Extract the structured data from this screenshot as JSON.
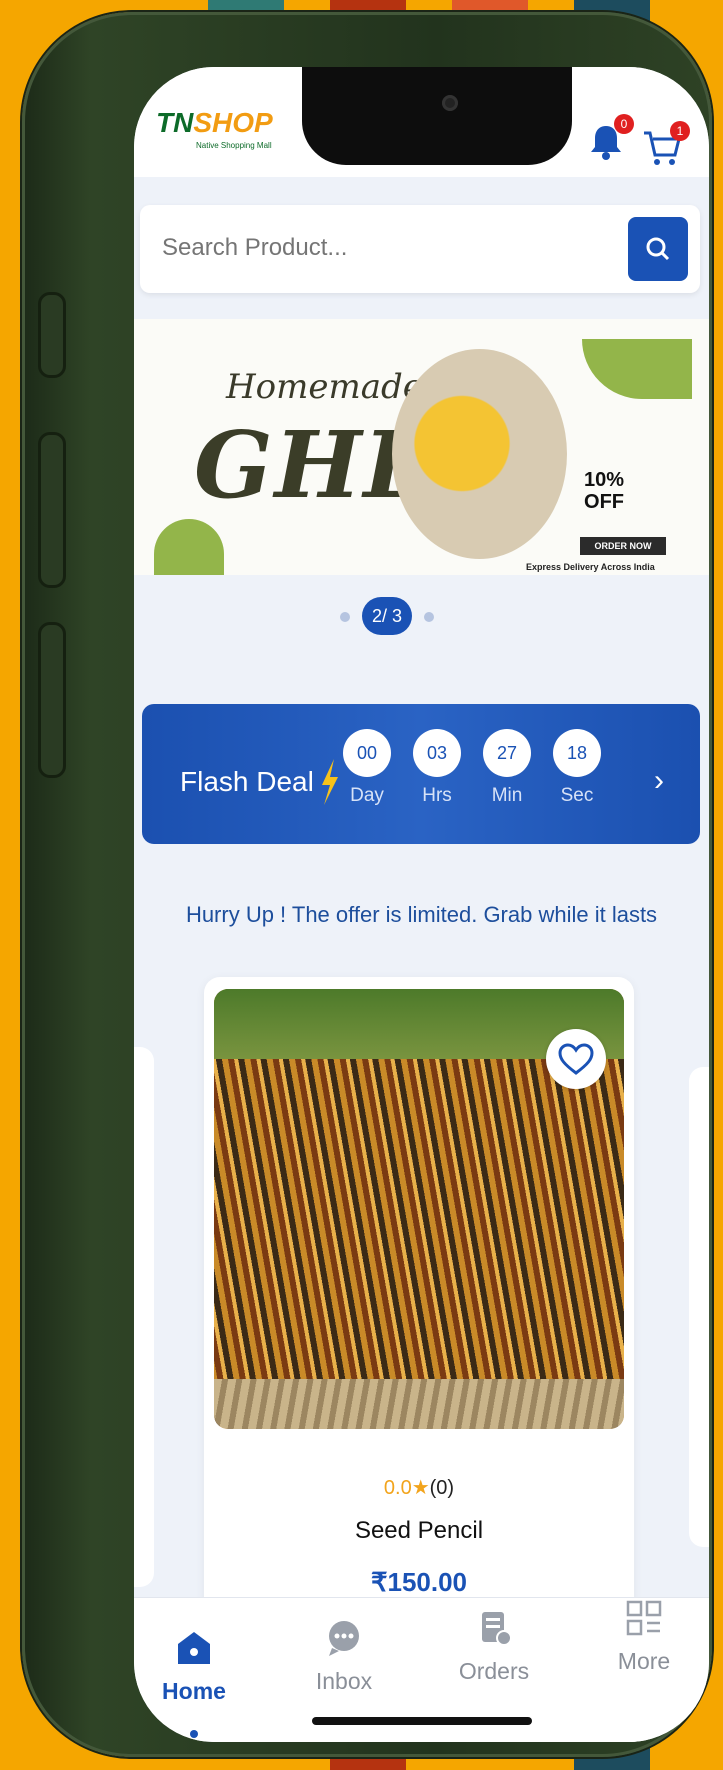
{
  "header": {
    "logo_tn": "TN",
    "logo_shop": "SHOP",
    "logo_tagline": "Native Shopping Mall",
    "notification_count": "0",
    "cart_count": "1"
  },
  "search": {
    "placeholder": "Search Product..."
  },
  "banner": {
    "line1": "Homemade",
    "line2": "GHEE",
    "offer_line1": "10%",
    "offer_line2": "OFF",
    "cta": "ORDER NOW",
    "footer": "Express Delivery Across India",
    "page_indicator": "2/ 3"
  },
  "flash_deal": {
    "title": "Flash Deal",
    "timers": [
      {
        "value": "00",
        "label": "Day"
      },
      {
        "value": "03",
        "label": "Hrs"
      },
      {
        "value": "27",
        "label": "Min"
      },
      {
        "value": "18",
        "label": "Sec"
      }
    ]
  },
  "hurry_text": "Hurry Up ! The offer is limited. Grab while it lasts",
  "product": {
    "rating": "0.0",
    "rating_count": "(0)",
    "name": "Seed Pencil",
    "price": "₹150.00"
  },
  "bottom_nav": [
    {
      "label": "Home",
      "icon": "home-icon",
      "active": true
    },
    {
      "label": "Inbox",
      "icon": "chat-icon",
      "active": false
    },
    {
      "label": "Orders",
      "icon": "orders-icon",
      "active": false
    },
    {
      "label": "More",
      "icon": "grid-icon",
      "active": false
    }
  ],
  "colors": {
    "primary": "#1a52b5",
    "background": "#f5a600",
    "phone": "#2f4426",
    "rating_star": "#f2a41c"
  }
}
